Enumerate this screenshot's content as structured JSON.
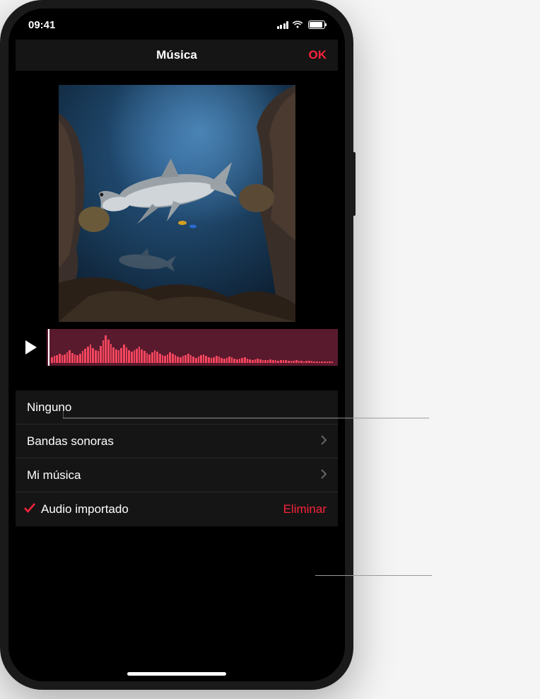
{
  "statusBar": {
    "time": "09:41"
  },
  "nav": {
    "title": "Música",
    "done": "OK"
  },
  "options": {
    "none": "Ninguno",
    "soundtracks": "Bandas sonoras",
    "myMusic": "Mi música",
    "importedAudio": "Audio importado",
    "delete": "Eliminar"
  },
  "colors": {
    "accent": "#fa233b",
    "waveform": "#f5465e",
    "waveformBg": "#5a1a2e"
  }
}
